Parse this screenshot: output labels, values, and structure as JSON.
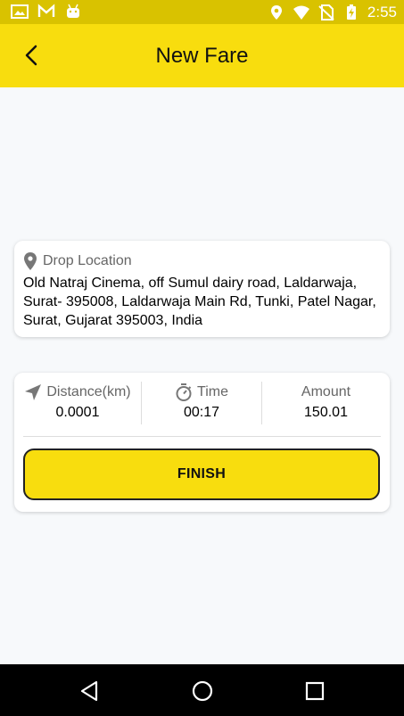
{
  "status_bar": {
    "time": "2:55",
    "left_icons": [
      "image-icon",
      "gmail-icon",
      "android-icon"
    ],
    "right_icons": [
      "location-icon",
      "wifi-icon",
      "no-sim-icon",
      "battery-charging-icon"
    ]
  },
  "app_bar": {
    "title": "New Fare",
    "back_icon": "chevron-left-icon"
  },
  "drop_card": {
    "label": "Drop Location",
    "address": "Old Natraj Cinema, off Sumul dairy road, Laldarwaja, Surat- 395008, Laldarwaja Main Rd, Tunki, Patel Nagar, Surat, Gujarat 395003, India"
  },
  "fare_card": {
    "metrics": [
      {
        "label": "Distance(km)",
        "value": "0.0001",
        "icon": "navigation-arrow-icon"
      },
      {
        "label": "Time",
        "value": "00:17",
        "icon": "stopwatch-icon"
      },
      {
        "label": "Amount",
        "value": "150.01"
      }
    ],
    "finish_label": "FINISH"
  },
  "colors": {
    "accent": "#f8dd0e",
    "status_bar": "#d9c200",
    "background": "#f7f9fb",
    "nav_bar": "#000000"
  },
  "nav_bar": [
    "back-triangle-icon",
    "home-circle-icon",
    "recents-square-icon"
  ]
}
